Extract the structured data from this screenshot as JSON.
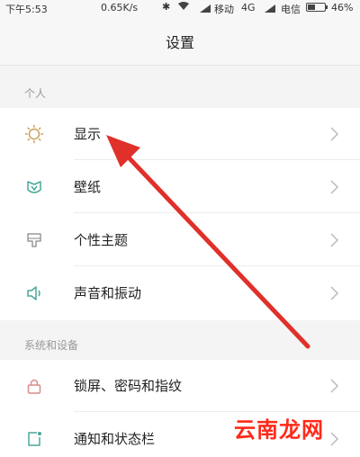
{
  "status_bar": {
    "time": "下午5:53",
    "speed": "0.65K/s",
    "carrier1": "移动",
    "network": "4G",
    "carrier2": "电信",
    "battery": "46%"
  },
  "header": {
    "title": "设置"
  },
  "sections": [
    {
      "title": "个人",
      "items": [
        {
          "label": "显示",
          "icon": "sun-icon"
        },
        {
          "label": "壁纸",
          "icon": "wallpaper-icon"
        },
        {
          "label": "个性主题",
          "icon": "theme-icon"
        },
        {
          "label": "声音和振动",
          "icon": "speaker-icon"
        }
      ]
    },
    {
      "title": "系统和设备",
      "items": [
        {
          "label": "锁屏、密码和指纹",
          "icon": "lock-icon"
        },
        {
          "label": "通知和状态栏",
          "icon": "notification-icon"
        }
      ]
    }
  ],
  "watermark": "云南龙网",
  "colors": {
    "accent": "#5fb6a8",
    "arrow": "#e0302a",
    "watermark": "#ff2a1a"
  }
}
